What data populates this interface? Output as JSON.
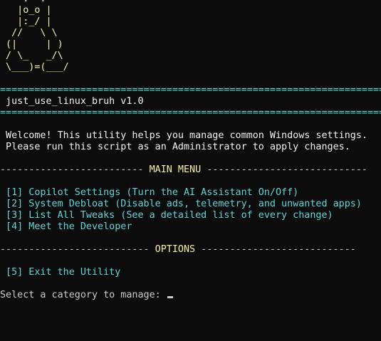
{
  "ascii_logo": [
    "    .--.",
    "   |o_o |",
    "   |:_/ |",
    "  //   \\ \\",
    " (|     | )",
    " / \\_   _/\\",
    " \\___)=(___/"
  ],
  "banner": {
    "rule": "=====================================================================",
    "title": " just_use_linux_bruh v1.0"
  },
  "welcome": {
    "line1": " Welcome! This utility helps you manage common Windows settings.",
    "line2": " Please run this script as an Administrator to apply changes."
  },
  "main_menu": {
    "dashes_left": "------------------------- ",
    "label": "MAIN MENU",
    "dashes_right": " ----------------------------",
    "items": [
      " [1] Copilot Settings (Turn the AI Assistant On/Off)",
      " [2] System Debloat (Disable ads, telemetry, and unwanted apps)",
      " [3] List All Tweaks (See a detailed list of every change)",
      " [4] Meet the Developer"
    ]
  },
  "options_menu": {
    "dashes_left": "-------------------------- ",
    "label": "OPTIONS",
    "dashes_right": " ---------------------------",
    "items": [
      " [5] Exit the Utility"
    ]
  },
  "prompt": {
    "text": "Select a category to manage: "
  },
  "colors": {
    "background": "#0c0c0c",
    "default_text": "#cccccc",
    "yellow": "#f9f1a5",
    "cyan": "#61d6d6"
  }
}
